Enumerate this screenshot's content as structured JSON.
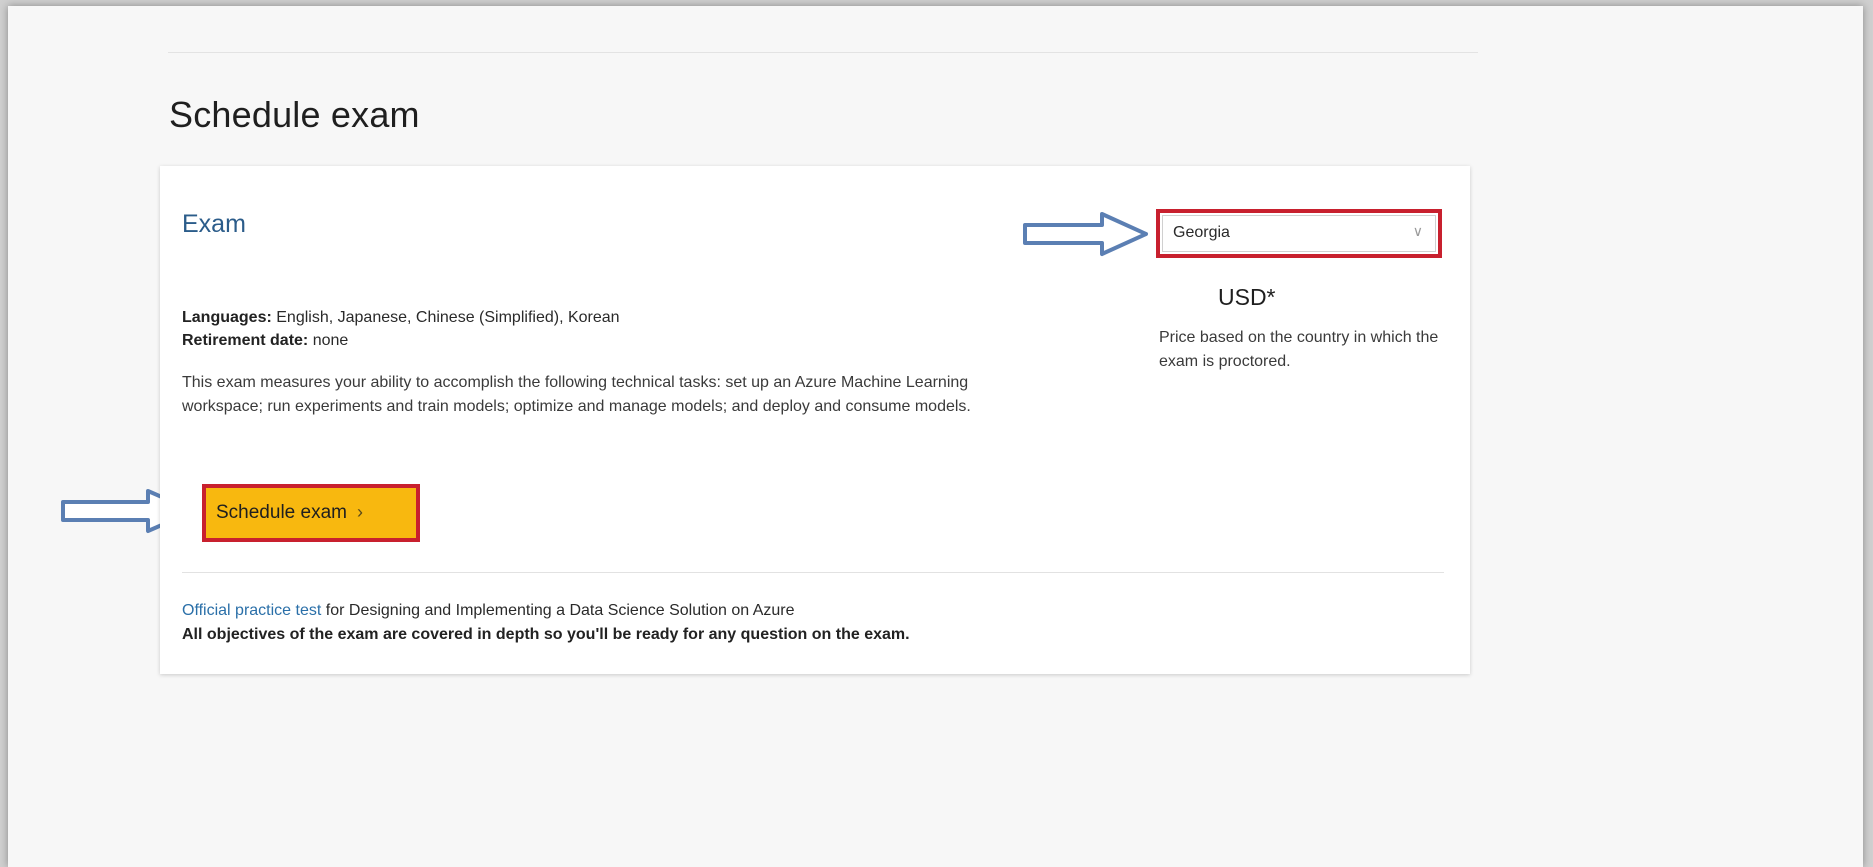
{
  "page": {
    "title": "Schedule exam"
  },
  "card": {
    "heading": "Exam",
    "languages_label": "Languages:",
    "languages_value": "English, Japanese, Chinese (Simplified), Korean",
    "retirement_label": "Retirement date:",
    "retirement_value": "none",
    "description": "This exam measures your ability to accomplish the following technical tasks: set up an Azure Machine Learning workspace; run experiments and train models; optimize and manage models; and deploy and consume models.",
    "schedule_button_label": "Schedule exam",
    "schedule_button_icon": "chevron-right-icon",
    "practice_link": "Official practice test",
    "practice_text": "for Designing and Implementing a Data Science Solution on Azure",
    "objectives_text": "All objectives of the exam are covered in depth so you'll be ready for any question on the exam."
  },
  "pricing": {
    "country_selected": "Georgia",
    "dropdown_icon": "chevron-down-icon",
    "price": "USD*",
    "note": "Price based on the country in which the exam is proctored."
  },
  "annotations": {
    "highlight_color": "#c8202e",
    "arrow_color": "#5b7fb3",
    "button_color": "#f8b80f",
    "link_color": "#2a6fa8"
  }
}
